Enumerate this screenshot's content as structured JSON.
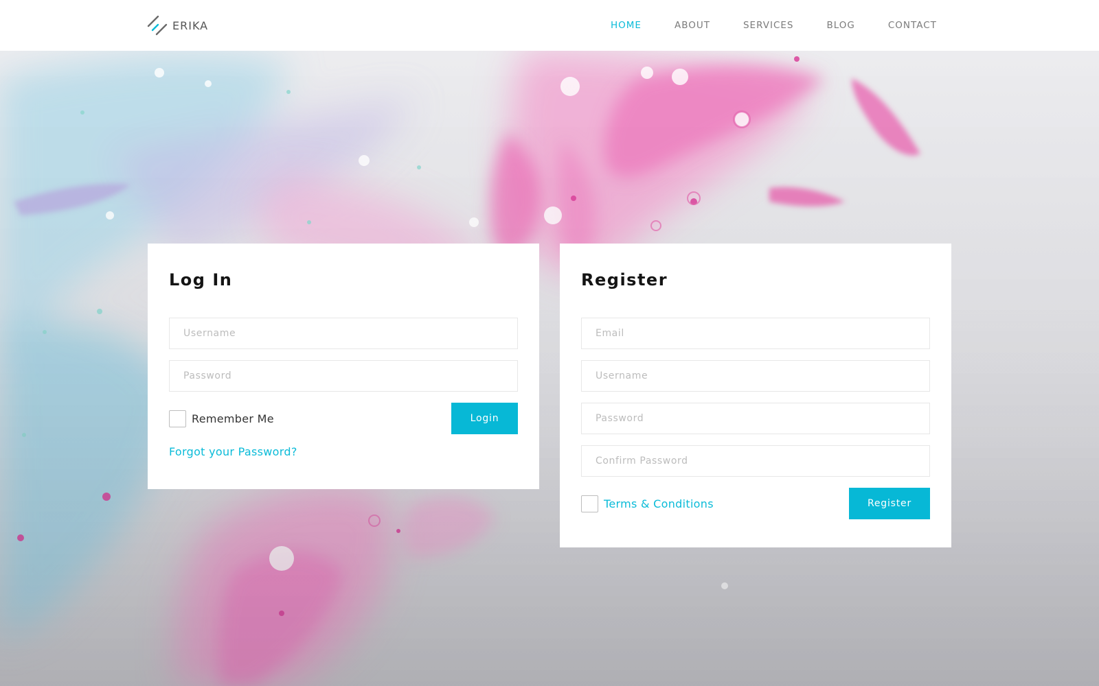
{
  "brand": {
    "name": "ERIKA"
  },
  "nav": {
    "items": [
      {
        "label": "HOME",
        "active": true
      },
      {
        "label": "ABOUT",
        "active": false
      },
      {
        "label": "SERVICES",
        "active": false
      },
      {
        "label": "BLOG",
        "active": false
      },
      {
        "label": "CONTACT",
        "active": false
      }
    ]
  },
  "login": {
    "title": "Log In",
    "username_placeholder": "Username",
    "password_placeholder": "Password",
    "remember_label": "Remember Me",
    "remember_checked": false,
    "button_label": "Login",
    "forgot_label": "Forgot your Password?"
  },
  "register": {
    "title": "Register",
    "email_placeholder": "Email",
    "username_placeholder": "Username",
    "password_placeholder": "Password",
    "confirm_placeholder": "Confirm Password",
    "terms_label": "Terms & Conditions",
    "terms_checked": false,
    "button_label": "Register"
  },
  "colors": {
    "accent": "#0abbd8",
    "button": "#07b8d6",
    "header_bg": "#ffffff",
    "card_bg": "#ffffff",
    "nav_text": "#7b7b7b",
    "background_pink": "#f089c4",
    "background_blue": "#9fd3e6"
  },
  "icons": {
    "logo": "double-slash-logo-icon"
  }
}
